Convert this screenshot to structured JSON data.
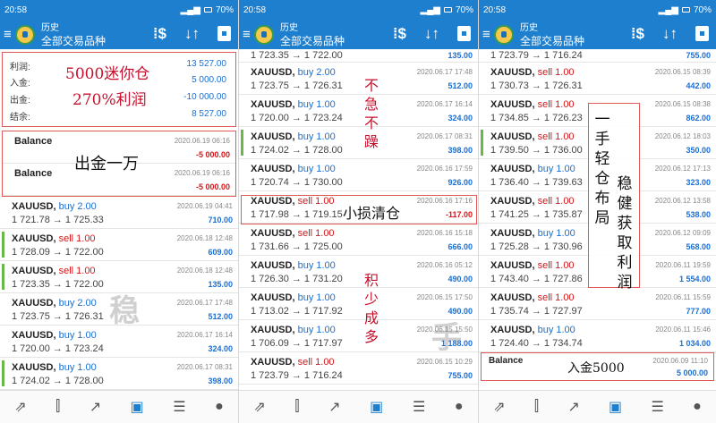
{
  "status": {
    "time": "20:58",
    "battery": "70%"
  },
  "header": {
    "subtitle": "历史",
    "title": "全部交易品种"
  },
  "icons": {
    "menu": "hamburger-icon",
    "sort": "sort-arrows-icon",
    "dollar": "currency-icon",
    "calendar": "calendar-icon"
  },
  "panel1": {
    "summary": {
      "profit_label": "利润:",
      "profit": "13 527.00",
      "deposit_label": "入金:",
      "deposit": "5 000.00",
      "withdraw_label": "出金:",
      "withdraw": "-10 000.00",
      "balance_label": "结余:",
      "balance": "8 527.00"
    },
    "balances": [
      {
        "label": "Balance",
        "date": "2020.06.19 06:16",
        "amount": "-5 000.00"
      },
      {
        "label": "Balance",
        "date": "2020.06.19 06:16",
        "amount": "-5 000.00"
      }
    ],
    "trades": [
      {
        "symbol": "XAUUSD,",
        "side": "buy 2.00",
        "type": "buy",
        "prices": "1 721.78 → 1 725.33",
        "date": "2020.06.19 04:41",
        "profit": "710.00",
        "bar": false
      },
      {
        "symbol": "XAUUSD,",
        "side": "sell 1.00",
        "type": "sell",
        "prices": "1 728.09 → 1 722.00",
        "date": "2020.06.18 12:48",
        "profit": "609.00",
        "bar": true
      },
      {
        "symbol": "XAUUSD,",
        "side": "sell 1.00",
        "type": "sell",
        "prices": "1 723.35 → 1 722.00",
        "date": "2020.06.18 12:48",
        "profit": "135.00",
        "bar": true
      },
      {
        "symbol": "XAUUSD,",
        "side": "buy 2.00",
        "type": "buy",
        "prices": "1 723.75 → 1 726.31",
        "date": "2020.06.17 17:48",
        "profit": "512.00",
        "bar": false
      },
      {
        "symbol": "XAUUSD,",
        "side": "buy 1.00",
        "type": "buy",
        "prices": "1 720.00 → 1 723.24",
        "date": "2020.06.17 16:14",
        "profit": "324.00",
        "bar": false
      },
      {
        "symbol": "XAUUSD,",
        "side": "buy 1.00",
        "type": "buy",
        "prices": "1 724.02 → 1 728.00",
        "date": "2020.06.17 08:31",
        "profit": "398.00",
        "bar": true
      }
    ],
    "notes": {
      "summary": "5000迷你仓",
      "summary2": "270%利润",
      "withdraw": "出金一万",
      "watermark": "稳"
    }
  },
  "panel2": {
    "top_partial": {
      "prices": "1 723.35 → 1 722.00",
      "profit": "135.00"
    },
    "trades": [
      {
        "symbol": "XAUUSD,",
        "side": "buy 2.00",
        "type": "buy",
        "prices": "1 723.75 → 1 726.31",
        "date": "2020.06.17 17:48",
        "profit": "512.00",
        "bar": false
      },
      {
        "symbol": "XAUUSD,",
        "side": "buy 1.00",
        "type": "buy",
        "prices": "1 720.00 → 1 723.24",
        "date": "2020.06.17 16:14",
        "profit": "324.00",
        "bar": false
      },
      {
        "symbol": "XAUUSD,",
        "side": "buy 1.00",
        "type": "buy",
        "prices": "1 724.02 → 1 728.00",
        "date": "2020.06.17 08:31",
        "profit": "398.00",
        "bar": true
      },
      {
        "symbol": "XAUUSD,",
        "side": "buy 1.00",
        "type": "buy",
        "prices": "1 720.74 → 1 730.00",
        "date": "2020.06.16 17:59",
        "profit": "926.00",
        "bar": false
      },
      {
        "symbol": "XAUUSD,",
        "side": "sell 1.00",
        "type": "sell",
        "prices": "1 717.98 → 1 719.15",
        "date": "2020.06.16 17:16",
        "profit": "-117.00",
        "bar": false
      },
      {
        "symbol": "XAUUSD,",
        "side": "sell 1.00",
        "type": "sell",
        "prices": "1 731.66 → 1 725.00",
        "date": "2020.06.16 15:18",
        "profit": "666.00",
        "bar": false
      },
      {
        "symbol": "XAUUSD,",
        "side": "buy 1.00",
        "type": "buy",
        "prices": "1 726.30 → 1 731.20",
        "date": "2020.06.16 05:12",
        "profit": "490.00",
        "bar": false
      },
      {
        "symbol": "XAUUSD,",
        "side": "buy 1.00",
        "type": "buy",
        "prices": "1 713.02 → 1 717.92",
        "date": "2020.06.15 17:50",
        "profit": "490.00",
        "bar": false
      },
      {
        "symbol": "XAUUSD,",
        "side": "buy 1.00",
        "type": "buy",
        "prices": "1 706.09 → 1 717.97",
        "date": "2020.06.15 15:50",
        "profit": "1 188.00",
        "bar": false
      },
      {
        "symbol": "XAUUSD,",
        "side": "sell 1.00",
        "type": "sell",
        "prices": "1 723.79 → 1 716.24",
        "date": "2020.06.15 10:29",
        "profit": "755.00",
        "bar": false
      }
    ],
    "notes": {
      "n1": "不急不躁",
      "n2": "小损清仓",
      "n3": "积少成多",
      "watermark": "手"
    }
  },
  "panel3": {
    "top_partial": {
      "prices": "1 723.79 → 1 716.24",
      "profit": "755.00"
    },
    "trades": [
      {
        "symbol": "XAUUSD,",
        "side": "sell 1.00",
        "type": "sell",
        "prices": "1 730.73 → 1 726.31",
        "date": "2020.06.15 08:39",
        "profit": "442.00",
        "bar": false
      },
      {
        "symbol": "XAUUSD,",
        "side": "sell 1.00",
        "type": "sell",
        "prices": "1 734.85 → 1 726.23",
        "date": "2020.06.15 08:38",
        "profit": "862.00",
        "bar": false
      },
      {
        "symbol": "XAUUSD,",
        "side": "sell 1.00",
        "type": "sell",
        "prices": "1 739.50 → 1 736.00",
        "date": "2020.06.12 18:03",
        "profit": "350.00",
        "bar": true
      },
      {
        "symbol": "XAUUSD,",
        "side": "buy 1.00",
        "type": "buy",
        "prices": "1 736.40 → 1 739.63",
        "date": "2020.06.12 17:13",
        "profit": "323.00",
        "bar": false
      },
      {
        "symbol": "XAUUSD,",
        "side": "sell 1.00",
        "type": "sell",
        "prices": "1 741.25 → 1 735.87",
        "date": "2020.06.12 13:58",
        "profit": "538.00",
        "bar": false
      },
      {
        "symbol": "XAUUSD,",
        "side": "buy 1.00",
        "type": "buy",
        "prices": "1 725.28 → 1 730.96",
        "date": "2020.06.12 09:09",
        "profit": "568.00",
        "bar": false
      },
      {
        "symbol": "XAUUSD,",
        "side": "sell 1.00",
        "type": "sell",
        "prices": "1 743.40 → 1 727.86",
        "date": "2020.06.11 19:59",
        "profit": "1 554.00",
        "bar": false
      },
      {
        "symbol": "XAUUSD,",
        "side": "sell 1.00",
        "type": "sell",
        "prices": "1 735.74 → 1 727.97",
        "date": "2020.06.11 15:59",
        "profit": "777.00",
        "bar": false
      },
      {
        "symbol": "XAUUSD,",
        "side": "buy 1.00",
        "type": "buy",
        "prices": "1 724.40 → 1 734.74",
        "date": "2020.06.11 15:46",
        "profit": "1 034.00",
        "bar": false
      }
    ],
    "balance": {
      "label": "Balance",
      "date": "2020.06.09 11:10",
      "amount": "5 000.00"
    },
    "notes": {
      "n1": "一手轻仓布局",
      "n2": "稳健获取利润",
      "deposit": "入金5000",
      "watermark": "手"
    }
  },
  "colors": {
    "accent": "#1e7fcf",
    "buy": "#1b6fd1",
    "sell": "#d4161a",
    "note": "#c8102e"
  }
}
